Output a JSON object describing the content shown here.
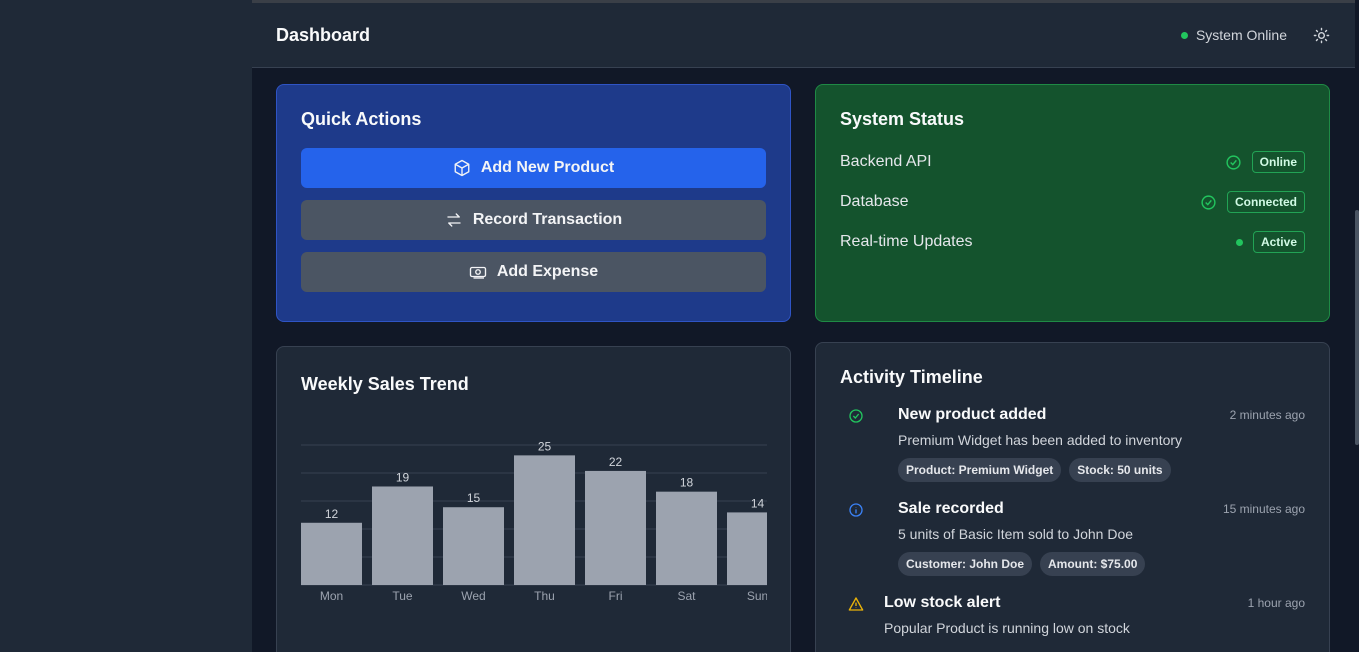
{
  "header": {
    "title": "Dashboard",
    "status_text": "System Online"
  },
  "quick_actions": {
    "title": "Quick Actions",
    "buttons": [
      {
        "label": "Add New Product",
        "icon": "cube-icon"
      },
      {
        "label": "Record Transaction",
        "icon": "arrows-swap-icon"
      },
      {
        "label": "Add Expense",
        "icon": "cash-icon"
      }
    ]
  },
  "system_status": {
    "title": "System Status",
    "rows": [
      {
        "label": "Backend API",
        "badge": "Online",
        "indicator": "check-circle-icon"
      },
      {
        "label": "Database",
        "badge": "Connected",
        "indicator": "check-circle-icon"
      },
      {
        "label": "Real-time Updates",
        "badge": "Active",
        "indicator": "green-dot"
      }
    ]
  },
  "sales": {
    "title": "Weekly Sales Trend"
  },
  "chart_data": {
    "type": "bar",
    "categories": [
      "Mon",
      "Tue",
      "Wed",
      "Thu",
      "Fri",
      "Sat",
      "Sun"
    ],
    "values": [
      12,
      19,
      15,
      25,
      22,
      18,
      14
    ],
    "ylim": [
      0,
      27
    ],
    "grid": true,
    "bar_color": "#9ca3af"
  },
  "activity": {
    "title": "Activity Timeline",
    "items": [
      {
        "title": "New product added",
        "time": "2 minutes ago",
        "desc": "Premium Widget has been added to inventory",
        "tags": [
          "Product: Premium Widget",
          "Stock: 50 units"
        ],
        "icon": "check-circle-icon"
      },
      {
        "title": "Sale recorded",
        "time": "15 minutes ago",
        "desc": "5 units of Basic Item sold to John Doe",
        "tags": [
          "Customer: John Doe",
          "Amount: $75.00"
        ],
        "icon": "info-circle-icon"
      },
      {
        "title": "Low stock alert",
        "time": "1 hour ago",
        "desc": "Popular Product is running low on stock",
        "tags": [],
        "icon": "warning-triangle-icon"
      }
    ]
  },
  "colors": {
    "accent": "#2563eb",
    "success": "#22c55e",
    "info": "#3b82f6",
    "warning": "#eab308"
  }
}
